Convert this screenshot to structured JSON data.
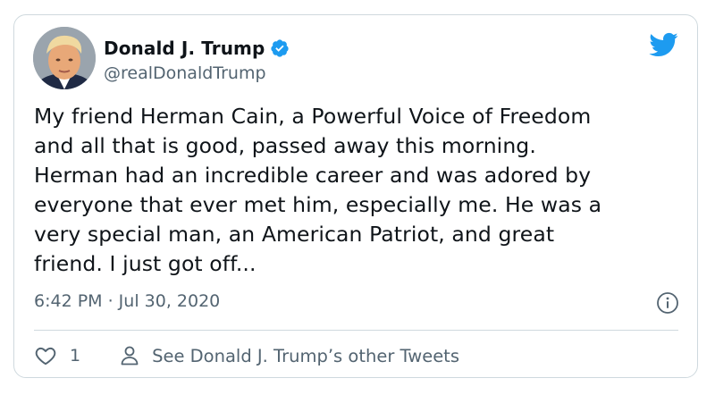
{
  "author": {
    "display_name": "Donald J. Trump",
    "handle": "@realDonaldTrump",
    "verified": true
  },
  "tweet": {
    "text": "My friend Herman Cain, a Powerful Voice of Freedom\nand all that is good, passed away this morning.\nHerman had an incredible career and was adored by\neveryone that ever met him, especially me. He was a\nvery special man, an American Patriot, and great\nfriend. I just got off...",
    "timestamp": "6:42 PM · Jul 30, 2020"
  },
  "actions": {
    "like_count": "1",
    "other_tweets_label": "See Donald J. Trump’s other Tweets"
  },
  "icons": {
    "brand": "twitter-bird-icon",
    "verified": "verified-badge-icon",
    "info": "info-icon",
    "like": "heart-icon",
    "profile": "person-icon"
  },
  "colors": {
    "brand_blue": "#1d9bf0",
    "text_primary": "#0f1419",
    "text_secondary": "#536471",
    "border": "#cfd9de"
  }
}
